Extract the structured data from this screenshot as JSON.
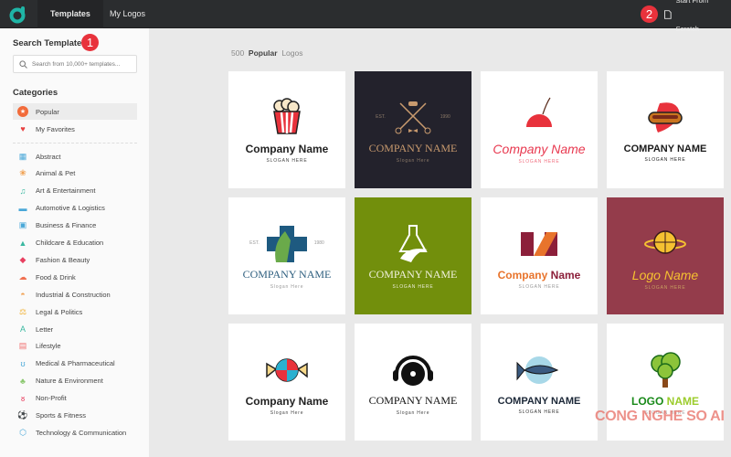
{
  "topbar": {
    "tabs": [
      {
        "label": "Templates",
        "active": true
      },
      {
        "label": "My Logos",
        "active": false
      }
    ],
    "start_label": "Start From Scratch",
    "brand_color": "#1fb5a6"
  },
  "badges": [
    "1",
    "2"
  ],
  "sidebar": {
    "search_title": "Search Templates",
    "search_placeholder": "Search from 10,000+ templates...",
    "categories_title": "Categories",
    "pinned": [
      {
        "label": "Popular",
        "icon": "star-icon",
        "selected": true
      },
      {
        "label": "My Favorites",
        "icon": "heart-icon"
      }
    ],
    "items": [
      {
        "label": "Abstract",
        "icon": "abstract-icon"
      },
      {
        "label": "Animal & Pet",
        "icon": "paw-icon"
      },
      {
        "label": "Art & Entertainment",
        "icon": "music-icon"
      },
      {
        "label": "Automotive & Logistics",
        "icon": "car-icon"
      },
      {
        "label": "Business & Finance",
        "icon": "briefcase-icon"
      },
      {
        "label": "Childcare & Education",
        "icon": "graduation-cap-icon"
      },
      {
        "label": "Fashion & Beauty",
        "icon": "diamond-icon"
      },
      {
        "label": "Food & Drink",
        "icon": "chef-hat-icon"
      },
      {
        "label": "Industrial & Construction",
        "icon": "hard-hat-icon"
      },
      {
        "label": "Legal & Politics",
        "icon": "scales-icon"
      },
      {
        "label": "Letter",
        "icon": "letter-a-icon"
      },
      {
        "label": "Lifestyle",
        "icon": "gift-icon"
      },
      {
        "label": "Medical & Pharmaceutical",
        "icon": "stethoscope-icon"
      },
      {
        "label": "Nature & Environment",
        "icon": "tree-icon"
      },
      {
        "label": "Non-Profit",
        "icon": "ribbon-icon"
      },
      {
        "label": "Sports & Fitness",
        "icon": "soccer-ball-icon"
      },
      {
        "label": "Technology & Communication",
        "icon": "tech-icon"
      }
    ]
  },
  "main": {
    "count": "500",
    "count_bold": "Popular",
    "count_suffix": "Logos",
    "cards": [
      {
        "name": "Company Name",
        "slogan": "SLOGAN HERE",
        "icon": "popcorn-icon",
        "bg": "#ffffff",
        "color": "#222222",
        "slogan_color": "#444444"
      },
      {
        "name": "COMPANY NAME",
        "slogan": "Slogan Here",
        "icon": "scissors-icon",
        "bg": "#23222c",
        "color": "#c89a6e",
        "slogan_color": "#8c7a68",
        "left": "EST.",
        "right": "1990"
      },
      {
        "name": "Company Name",
        "slogan": "SLOGAN HERE",
        "icon": "cherry-icon",
        "bg": "#ffffff",
        "color": "#e8384f",
        "slogan_color": "#f07080"
      },
      {
        "name": "COMPANY NAME",
        "slogan": "SLOGAN HERE",
        "icon": "hotdog-icon",
        "bg": "#ffffff",
        "color": "#1a1a1a",
        "slogan_color": "#222222"
      },
      {
        "name": "COMPANY NAME",
        "slogan": "Slogan Here",
        "icon": "pet-cross-icon",
        "bg": "#ffffff",
        "color": "#2e5f7f",
        "slogan_color": "#999999",
        "left": "EST.",
        "right": "1980"
      },
      {
        "name": "COMPANY NAME",
        "slogan": "SLOGAN HERE",
        "icon": "flask-leaf-icon",
        "bg": "#728f0c",
        "color": "#f2f2e0",
        "slogan_color": "#eeeedd"
      },
      {
        "name": "Company Name",
        "slogan": "SLOGAN HERE",
        "icon": "film-strip-icon",
        "bg": "#ffffff",
        "color": "#e8742c",
        "slogan_color": "#999999",
        "name2": "Name",
        "color2": "#8c1f3a"
      },
      {
        "name": "Logo Name",
        "slogan": "SLOGAN HERE",
        "icon": "basketball-planet-icon",
        "bg": "#943c4b",
        "color": "#f5c131",
        "slogan_color": "#c9a060"
      },
      {
        "name": "Company Name",
        "slogan": "Slogan Here",
        "icon": "candy-icon",
        "bg": "#ffffff",
        "color": "#222222",
        "slogan_color": "#444444"
      },
      {
        "name": "COMPANY NAME",
        "slogan": "Slogan Here",
        "icon": "vinyl-headphones-icon",
        "bg": "#ffffff",
        "color": "#111111",
        "slogan_color": "#444444"
      },
      {
        "name": "COMPANY NAME",
        "slogan": "SLOGAN HERE",
        "icon": "tuna-fish-icon",
        "bg": "#ffffff",
        "color": "#1c2838",
        "slogan_color": "#333333"
      },
      {
        "name": "LOGO",
        "slogan": "SLOGAN HERE",
        "icon": "tree-icon",
        "bg": "#ffffff",
        "color": "#1a8a1a",
        "slogan_color": "#aaaaaa",
        "name2": "NAME",
        "color2": "#9ccc2c"
      }
    ]
  },
  "watermark": "CONG NGHE SO AI"
}
